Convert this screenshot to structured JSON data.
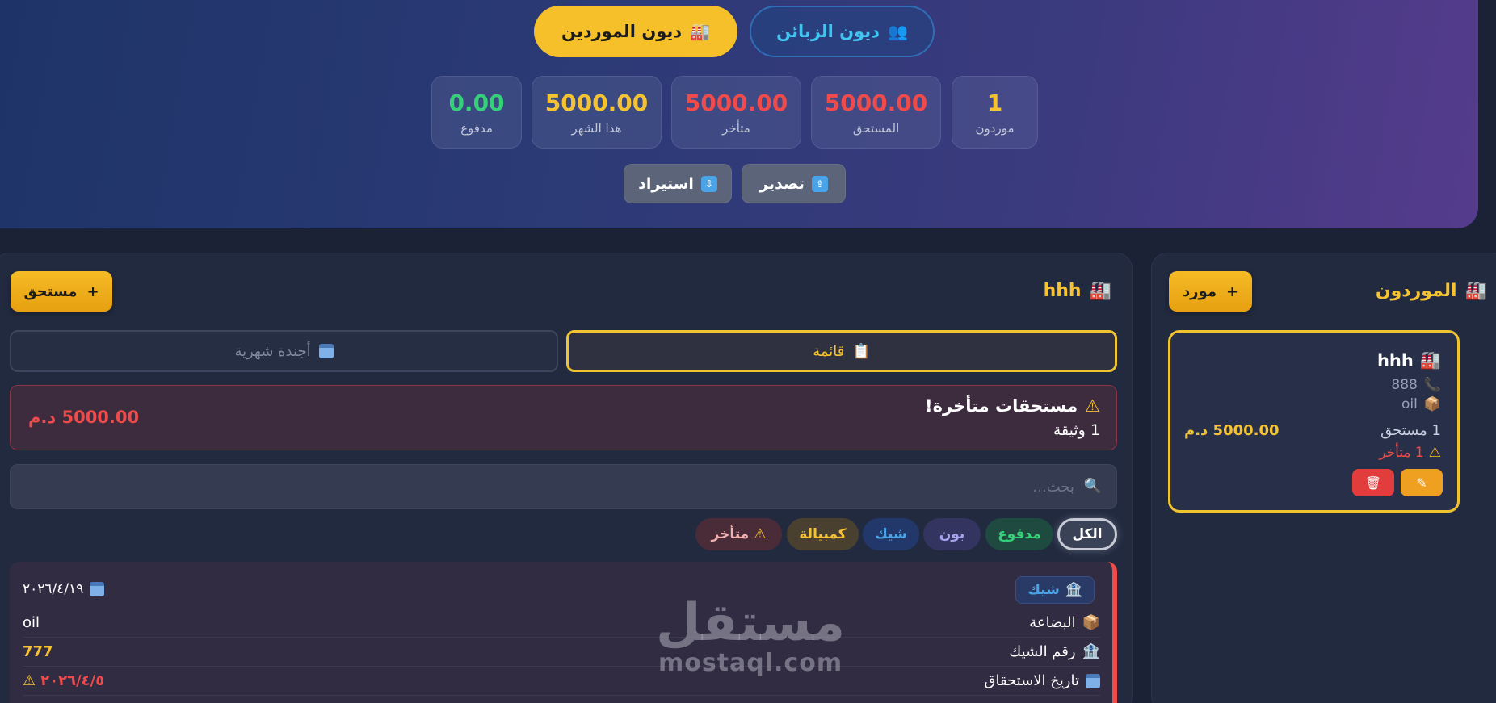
{
  "header": {
    "tabs": {
      "suppliers": {
        "label": "ديون الموردين",
        "icon": "factory-icon"
      },
      "customers": {
        "label": "ديون الزبائن",
        "icon": "people-icon"
      }
    },
    "stats": [
      {
        "value": "1",
        "label": "موردون",
        "color": "#f5c232"
      },
      {
        "value": "5000.00",
        "label": "المستحق",
        "color": "#ef4b4b"
      },
      {
        "value": "5000.00",
        "label": "متأخر",
        "color": "#ef4b4b"
      },
      {
        "value": "5000.00",
        "label": "هذا الشهر",
        "color": "#f5c232"
      },
      {
        "value": "0.00",
        "label": "مدفوع",
        "color": "#36d07a"
      }
    ],
    "export_label": "تصدير",
    "import_label": "استيراد"
  },
  "suppliers_panel": {
    "title": "الموردون",
    "add_label": "مورد",
    "card": {
      "name": "hhh",
      "phone": "888",
      "goods": "oil",
      "count": "1 مستحق",
      "amount": "5000.00 د.م",
      "late": "1 متأخر"
    }
  },
  "main_panel": {
    "title": "hhh",
    "add_label": "مستحق",
    "views": {
      "list": "قائمة",
      "calendar": "أجندة شهرية"
    },
    "alert": {
      "title": "مستحقات متأخرة!",
      "sub": "1 وثيقة",
      "amount": "5000.00 د.م"
    },
    "search_placeholder": "بحث...",
    "filters": {
      "all": "الكل",
      "paid": "مدفوع",
      "bon": "بون",
      "check": "شيك",
      "bill": "كمبيالة",
      "late": "متأخر"
    },
    "doc": {
      "type": "شيك",
      "date": "٢٠٢٦/٤/١٩",
      "goods_label": "البضاعة",
      "goods_value": "oil",
      "check_label": "رقم الشيك",
      "check_value": "777",
      "due_label": "تاريخ الاستحقاق",
      "due_value": "٢٠٢٦/٤/٥"
    }
  },
  "watermark": {
    "ar": "مستقل",
    "en": "mostaql.com"
  },
  "colors": {
    "accent": "#f5c232",
    "danger": "#ef4b4b",
    "success": "#36d07a",
    "info": "#4aa3e6"
  }
}
